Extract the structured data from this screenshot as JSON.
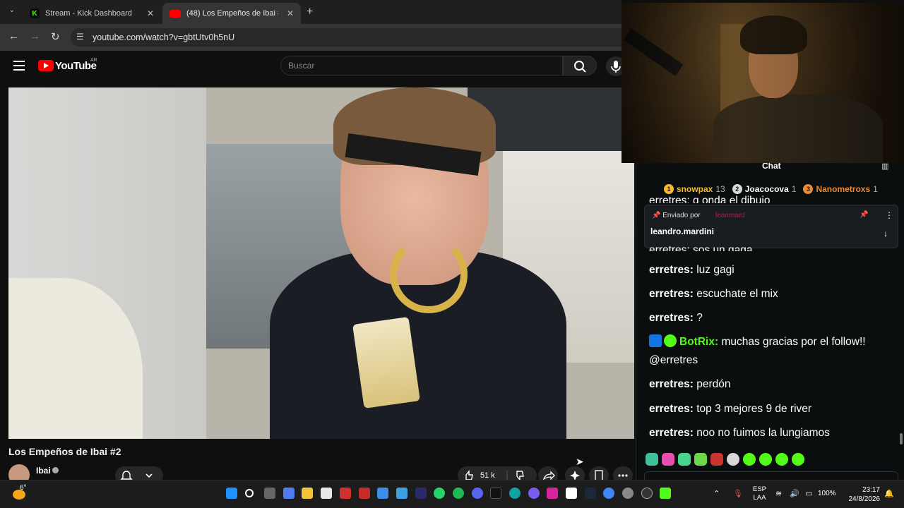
{
  "browser": {
    "tabs": [
      {
        "title": "Stream - Kick Dashboard",
        "favicon": "K",
        "favicon_color": "#53fc18"
      },
      {
        "title": "(48) Los Empeños de Ibai #…",
        "favicon_color": "#ff0000"
      }
    ],
    "url": "youtube.com/watch?v=gbtUtv0h5nU"
  },
  "youtube": {
    "logo_text": "YouTube",
    "country": "AR",
    "search_placeholder": "Buscar",
    "video_title": "Los Empeños de Ibai #2",
    "channel": "Ibai",
    "likes": "51 k"
  },
  "chat": {
    "title": "Chat",
    "leaderboard": [
      {
        "rank": "1",
        "name": "snowpax",
        "count": "13",
        "color": "#f5b82e"
      },
      {
        "rank": "2",
        "name": "Joacocova",
        "count": "1",
        "color": "#d9d9d9"
      },
      {
        "rank": "3",
        "name": "Nanometroxs",
        "count": "1",
        "color": "#e88b3a"
      }
    ],
    "pinned": {
      "by_label": "Enviado por",
      "sender": "leanmard",
      "message": "leandro.mardini"
    },
    "partial_top": "erretres: q onda el dibujo",
    "partial_mid": "erretres: sos un gaga",
    "messages": [
      {
        "user": "erretres",
        "text": "luz gagi"
      },
      {
        "user": "erretres",
        "text": "escuchate el mix"
      },
      {
        "user": "erretres",
        "text": "?"
      },
      {
        "user": "BotRix",
        "text": "muchas gracias por el follow!! @erretres",
        "bot": true
      },
      {
        "user": "erretres",
        "text": "perdón"
      },
      {
        "user": "erretres",
        "text": "top 3 mejores 9 de river"
      },
      {
        "user": "erretres",
        "text": "noo no fuimos la lungiamos"
      }
    ]
  },
  "taskbar": {
    "weather_temp": "6°",
    "lang_top": "ESP",
    "lang_bottom": "LAA",
    "battery": "100%",
    "time": "23:17",
    "date": "24/8/2026"
  }
}
